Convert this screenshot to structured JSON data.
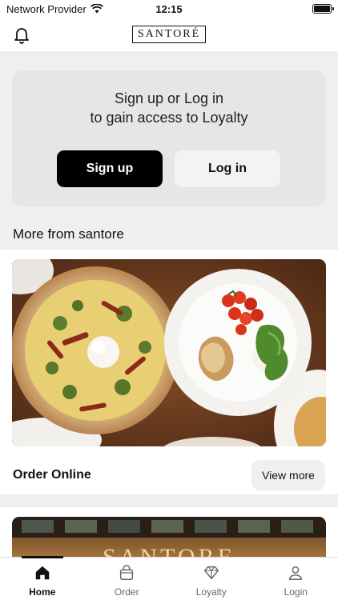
{
  "status_bar": {
    "carrier": "Network Provider",
    "time": "12:15",
    "icons": [
      "wifi-icon",
      "battery-icon"
    ]
  },
  "header": {
    "logo_text": "SANTORÉ",
    "left_icon": "bell-icon"
  },
  "loyalty": {
    "title_line1": "Sign up or Log in",
    "title_line2": "to gain access to Loyalty",
    "signup_label": "Sign up",
    "login_label": "Log in"
  },
  "section": {
    "title": "More from santore"
  },
  "promos": [
    {
      "title": "Order Online",
      "button_label": "View more",
      "image": "pizza-and-burrata-dishes"
    },
    {
      "image_text": "SANTORE",
      "image": "restaurant-storefront"
    }
  ],
  "tabs": [
    {
      "label": "Home",
      "icon": "home-icon",
      "active": true
    },
    {
      "label": "Order",
      "icon": "bag-icon",
      "active": false
    },
    {
      "label": "Loyalty",
      "icon": "diamond-icon",
      "active": false
    },
    {
      "label": "Login",
      "icon": "user-icon",
      "active": false
    }
  ],
  "colors": {
    "accent": "#000000",
    "background": "#efefef",
    "card": "#e6e6e8"
  }
}
